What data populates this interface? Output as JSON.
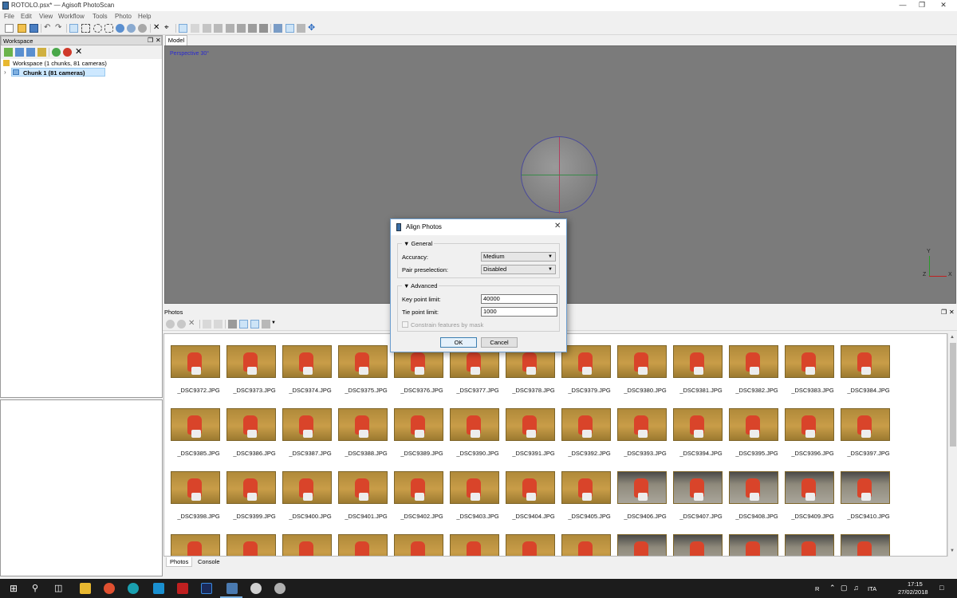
{
  "window": {
    "title": "ROTOLO.psx* — Agisoft PhotoScan"
  },
  "menu": [
    "File",
    "Edit",
    "View",
    "Workflow",
    "Tools",
    "Photo",
    "Help"
  ],
  "workspace": {
    "panel_title": "Workspace",
    "root_label": "Workspace (1 chunks, 81 cameras)",
    "chunk_label": "Chunk 1 (81 cameras)"
  },
  "model": {
    "tab_label": "Model",
    "view_label": "Perspective 30°",
    "axis_y": "Y",
    "axis_z": "Z",
    "axis_x": "X"
  },
  "photos": {
    "panel_title": "Photos",
    "items": [
      "_DSC9372.JPG",
      "_DSC9373.JPG",
      "_DSC9374.JPG",
      "_DSC9375.JPG",
      "_DSC9376.JPG",
      "_DSC9377.JPG",
      "_DSC9378.JPG",
      "_DSC9379.JPG",
      "_DSC9380.JPG",
      "_DSC9381.JPG",
      "_DSC9382.JPG",
      "_DSC9383.JPG",
      "_DSC9384.JPG",
      "_DSC9385.JPG",
      "_DSC9386.JPG",
      "_DSC9387.JPG",
      "_DSC9388.JPG",
      "_DSC9389.JPG",
      "_DSC9390.JPG",
      "_DSC9391.JPG",
      "_DSC9392.JPG",
      "_DSC9393.JPG",
      "_DSC9394.JPG",
      "_DSC9395.JPG",
      "_DSC9396.JPG",
      "_DSC9397.JPG",
      "_DSC9398.JPG",
      "_DSC9399.JPG",
      "_DSC9400.JPG",
      "_DSC9401.JPG",
      "_DSC9402.JPG",
      "_DSC9403.JPG",
      "_DSC9404.JPG",
      "_DSC9405.JPG",
      "_DSC9406.JPG",
      "_DSC9407.JPG",
      "_DSC9408.JPG",
      "_DSC9409.JPG",
      "_DSC9410.JPG"
    ]
  },
  "bottom_tabs": {
    "photos": "Photos",
    "console": "Console"
  },
  "dialog": {
    "title": "Align Photos",
    "general_title": "General",
    "accuracy_label": "Accuracy:",
    "accuracy_value": "Medium",
    "pair_label": "Pair preselection:",
    "pair_value": "Disabled",
    "advanced_title": "Advanced",
    "keypoint_label": "Key point limit:",
    "keypoint_value": "40000",
    "tiepoint_label": "Tie point limit:",
    "tiepoint_value": "1000",
    "constrain_label": "Constrain features by mask",
    "ok_label": "OK",
    "cancel_label": "Cancel"
  },
  "taskbar": {
    "lang": "ITA",
    "time": "17:15",
    "date": "27/02/2018",
    "tray_r": "R"
  }
}
